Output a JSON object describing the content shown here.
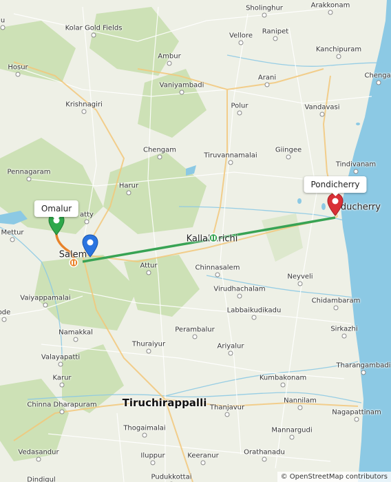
{
  "map": {
    "colors": {
      "land": "#eef0e6",
      "forest": "#c9dfb0",
      "water": "#8cc9e4",
      "road_major": "#f2c77a",
      "road_minor": "#ffffff",
      "route_orange": "#e8832a",
      "route_green": "#38a354",
      "pin_green": "#2ea84a",
      "pin_blue": "#2a74e0",
      "pin_red": "#d93036"
    },
    "places": [
      {
        "name": "Sholinghur",
        "type": "town"
      },
      {
        "name": "Arakkonam",
        "type": "town"
      },
      {
        "name": "Kolar Gold Fields",
        "type": "town"
      },
      {
        "name": "Vellore",
        "type": "town"
      },
      {
        "name": "Ranipet",
        "type": "town"
      },
      {
        "name": "Hosur",
        "type": "town"
      },
      {
        "name": "Ambur",
        "type": "town"
      },
      {
        "name": "Kanchipuram",
        "type": "town"
      },
      {
        "name": "Vaniyambadi",
        "type": "town"
      },
      {
        "name": "Arani",
        "type": "town"
      },
      {
        "name": "Chengal",
        "type": "town"
      },
      {
        "name": "Krishnagiri",
        "type": "town"
      },
      {
        "name": "Polur",
        "type": "town"
      },
      {
        "name": "Vandavasi",
        "type": "town"
      },
      {
        "name": "Chengam",
        "type": "town"
      },
      {
        "name": "Giingee",
        "type": "town"
      },
      {
        "name": "Tiruvannamalai",
        "type": "town"
      },
      {
        "name": "Tindivanam",
        "type": "town"
      },
      {
        "name": "Pennagaram",
        "type": "town"
      },
      {
        "name": "Harur",
        "type": "town"
      },
      {
        "name": "Puducherry",
        "type": "city"
      },
      {
        "name": "Mettur",
        "type": "town"
      },
      {
        "name": "Kallakurichi",
        "type": "city"
      },
      {
        "name": "Salem",
        "type": "city"
      },
      {
        "name": "Attur",
        "type": "town"
      },
      {
        "name": "Chinnasalem",
        "type": "town"
      },
      {
        "name": "Neyveli",
        "type": "town"
      },
      {
        "name": "Virudhachalam",
        "type": "town"
      },
      {
        "name": "Vaiyappamalai",
        "type": "town"
      },
      {
        "name": "Chidambaram",
        "type": "town"
      },
      {
        "name": "Labbaikudikadu",
        "type": "town"
      },
      {
        "name": "Namakkal",
        "type": "town"
      },
      {
        "name": "Perambalur",
        "type": "town"
      },
      {
        "name": "Sirkazhi",
        "type": "town"
      },
      {
        "name": "Thuraiyur",
        "type": "town"
      },
      {
        "name": "Ariyalur",
        "type": "town"
      },
      {
        "name": "Valayapatti",
        "type": "town"
      },
      {
        "name": "Tharangambadi",
        "type": "town"
      },
      {
        "name": "Karur",
        "type": "town"
      },
      {
        "name": "Kumbakonam",
        "type": "town"
      },
      {
        "name": "Tiruchirappalli",
        "type": "big"
      },
      {
        "name": "Chinna Dharapuram",
        "type": "town"
      },
      {
        "name": "Nannilam",
        "type": "town"
      },
      {
        "name": "Thanjavur",
        "type": "town"
      },
      {
        "name": "Nagapattinam",
        "type": "town"
      },
      {
        "name": "Thogaimalai",
        "type": "town"
      },
      {
        "name": "Mannargudi",
        "type": "town"
      },
      {
        "name": "Vedasandur",
        "type": "town"
      },
      {
        "name": "Iluppur",
        "type": "town"
      },
      {
        "name": "Keeranur",
        "type": "town"
      },
      {
        "name": "Orathanadu",
        "type": "town"
      },
      {
        "name": "Dindigul",
        "type": "town"
      },
      {
        "name": "Pudukkottai",
        "type": "town"
      },
      {
        "name": "atty",
        "type": "town"
      },
      {
        "name": "ode",
        "type": "town"
      },
      {
        "name": "u",
        "type": "town"
      }
    ],
    "markers": [
      {
        "label": "Omalur",
        "color": "green",
        "tooltip": true
      },
      {
        "label": "Salem",
        "color": "blue",
        "tooltip": false
      },
      {
        "label": "Pondicherry",
        "color": "red",
        "tooltip": true
      }
    ],
    "attribution": "© OpenStreetMap contributors"
  }
}
